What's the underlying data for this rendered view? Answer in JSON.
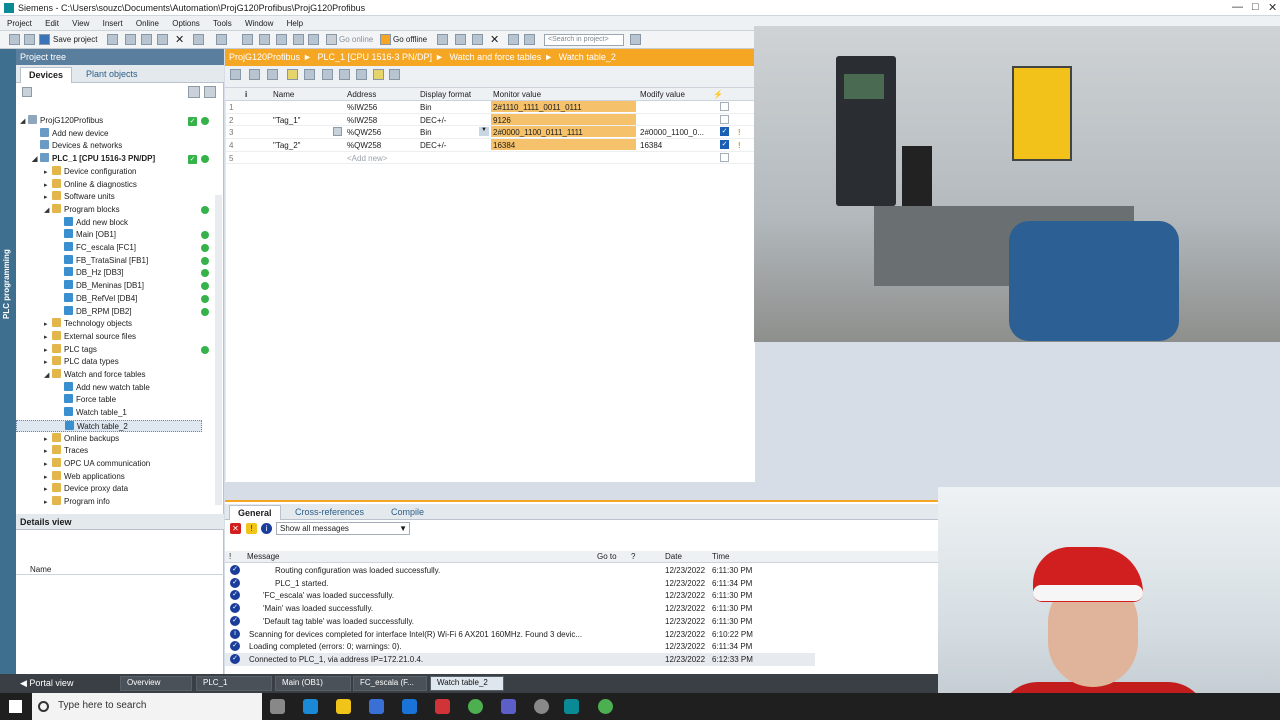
{
  "window": {
    "title": "Siemens  -  C:\\Users\\souzc\\Documents\\Automation\\ProjG120Profibus\\ProjG120Profibus"
  },
  "menu": [
    "Project",
    "Edit",
    "View",
    "Insert",
    "Online",
    "Options",
    "Tools",
    "Window",
    "Help"
  ],
  "toolbar": {
    "save": "Save project",
    "go_online": "Go online",
    "go_offline": "Go offline",
    "search_placeholder": "<Search in project>"
  },
  "sidestrip": {
    "label": "PLC programming"
  },
  "project_tree": {
    "header": "Project tree",
    "tabs": [
      "Devices",
      "Plant objects"
    ],
    "items": [
      {
        "label": "ProjG120Profibus",
        "depth": 0
      },
      {
        "label": "Add new device",
        "depth": 1
      },
      {
        "label": "Devices & networks",
        "depth": 1
      },
      {
        "label": "PLC_1 [CPU 1516-3 PN/DP]",
        "depth": 1
      },
      {
        "label": "Device configuration",
        "depth": 2
      },
      {
        "label": "Online & diagnostics",
        "depth": 2
      },
      {
        "label": "Software units",
        "depth": 2
      },
      {
        "label": "Program blocks",
        "depth": 2
      },
      {
        "label": "Add new block",
        "depth": 3
      },
      {
        "label": "Main [OB1]",
        "depth": 3
      },
      {
        "label": "FC_escala [FC1]",
        "depth": 3
      },
      {
        "label": "FB_TrataSinal [FB1]",
        "depth": 3
      },
      {
        "label": "DB_Hz [DB3]",
        "depth": 3
      },
      {
        "label": "DB_Meninas [DB1]",
        "depth": 3
      },
      {
        "label": "DB_RefVel [DB4]",
        "depth": 3
      },
      {
        "label": "DB_RPM [DB2]",
        "depth": 3
      },
      {
        "label": "Technology objects",
        "depth": 2
      },
      {
        "label": "External source files",
        "depth": 2
      },
      {
        "label": "PLC tags",
        "depth": 2
      },
      {
        "label": "PLC data types",
        "depth": 2
      },
      {
        "label": "Watch and force tables",
        "depth": 2
      },
      {
        "label": "Add new watch table",
        "depth": 3
      },
      {
        "label": "Force table",
        "depth": 3
      },
      {
        "label": "Watch table_1",
        "depth": 3
      },
      {
        "label": "Watch table_2",
        "depth": 3
      },
      {
        "label": "Online backups",
        "depth": 2
      },
      {
        "label": "Traces",
        "depth": 2
      },
      {
        "label": "OPC UA communication",
        "depth": 2
      },
      {
        "label": "Web applications",
        "depth": 2
      },
      {
        "label": "Device proxy data",
        "depth": 2
      },
      {
        "label": "Program info",
        "depth": 2
      }
    ]
  },
  "details_view": {
    "header": "Details view",
    "col": "Name"
  },
  "breadcrumb": [
    "ProjG120Profibus",
    "PLC_1 [CPU 1516-3 PN/DP]",
    "Watch and force tables",
    "Watch table_2"
  ],
  "watch_table": {
    "columns": [
      "i",
      "Name",
      "Address",
      "Display format",
      "Monitor value",
      "Modify value"
    ],
    "rows": [
      {
        "no": "1",
        "name": "",
        "address": "%IW256",
        "format": "Bin",
        "monitor": "2#1110_1111_0011_0111",
        "modify": ""
      },
      {
        "no": "2",
        "name": "\"Tag_1\"",
        "address": "%IW258",
        "format": "DEC+/-",
        "monitor": "9126",
        "modify": ""
      },
      {
        "no": "3",
        "name": "",
        "address": "%QW256",
        "format": "Bin",
        "monitor": "2#0000_1100_0111_1111",
        "modify": "2#0000_1100_0..."
      },
      {
        "no": "4",
        "name": "\"Tag_2\"",
        "address": "%QW258",
        "format": "DEC+/-",
        "monitor": "16384",
        "modify": "16384"
      },
      {
        "no": "5",
        "name": "",
        "address": "<Add new>",
        "format": "",
        "monitor": "",
        "modify": ""
      }
    ]
  },
  "inspector": {
    "tabs": [
      "General",
      "Cross-references",
      "Compile"
    ],
    "filter": "Show all messages",
    "columns": [
      "!",
      "Message",
      "Go to",
      "?",
      "Date",
      "Time"
    ],
    "messages": [
      {
        "indent": 3,
        "text": "Routing configuration was loaded successfully.",
        "date": "12/23/2022",
        "time": "6:11:30 PM"
      },
      {
        "indent": 3,
        "text": "PLC_1 started.",
        "date": "12/23/2022",
        "time": "6:11:34 PM"
      },
      {
        "indent": 2,
        "text": "'FC_escala' was loaded successfully.",
        "date": "12/23/2022",
        "time": "6:11:30 PM"
      },
      {
        "indent": 2,
        "text": "'Main' was loaded successfully.",
        "date": "12/23/2022",
        "time": "6:11:30 PM"
      },
      {
        "indent": 2,
        "text": "'Default tag table' was loaded successfully.",
        "date": "12/23/2022",
        "time": "6:11:30 PM"
      },
      {
        "indent": 1,
        "text": "Scanning for devices completed for interface Intel(R) Wi-Fi 6 AX201 160MHz. Found 3 devic...",
        "date": "12/23/2022",
        "time": "6:10:22 PM"
      },
      {
        "indent": 1,
        "text": "Loading completed (errors: 0; warnings: 0).",
        "date": "12/23/2022",
        "time": "6:11:34 PM"
      },
      {
        "indent": 1,
        "text": "Connected to PLC_1, via address IP=172.21.0.4.",
        "date": "12/23/2022",
        "time": "6:12:33 PM"
      }
    ]
  },
  "editor_tabs": {
    "portal": "Portal view",
    "tabs": [
      "Overview",
      "PLC_1",
      "Main (OB1)",
      "FC_escala (F...",
      "Watch table_2"
    ]
  },
  "taskbar": {
    "search": "Type here to search"
  },
  "colors": {
    "accent": "#f5a623",
    "monitor": "#f5c26b",
    "ok": "#35b34a",
    "tree_header": "#5a7f9e"
  }
}
